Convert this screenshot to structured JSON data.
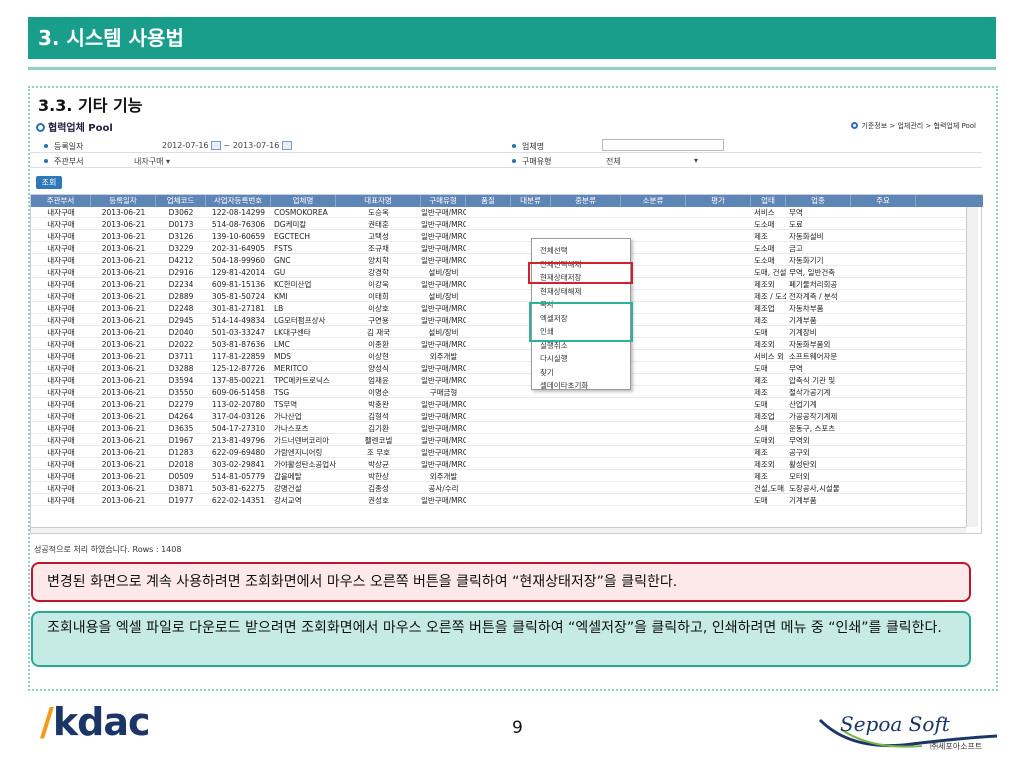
{
  "header": {
    "title": "3. 시스템 사용법"
  },
  "section": {
    "title": "3.3. 기타 기능"
  },
  "app": {
    "title": "협력업체 Pool",
    "breadcrumb": "기준정보 > 업체관리 > 협력업체 Pool",
    "form": {
      "reg_date_label": "등록일자",
      "date_from": "2012-07-16",
      "date_sep": "~",
      "date_to": "2013-07-16",
      "company_label": "업체명",
      "company_value": "",
      "dept_label": "주관부서",
      "dept_value": "내자구매",
      "purchase_type_label": "구매유형",
      "purchase_type_value": "전체"
    },
    "search_button": "조회",
    "columns": [
      "주관부서",
      "등록일자",
      "업체코드",
      "사업자등록번호",
      "업체명",
      "대표자명",
      "구매유형",
      "품질",
      "대분류",
      "중분류",
      "소분류",
      "평가",
      "업태",
      "업종",
      "주요"
    ],
    "rows": [
      [
        "내자구매",
        "2013-06-21",
        "D3062",
        "122-08-14299",
        "COSMOKOREA",
        "도승옥",
        "일반구매/MRO",
        "서비스",
        "무역"
      ],
      [
        "내자구매",
        "2013-06-21",
        "D0173",
        "514-08-76306",
        "DG케미칼",
        "권태훈",
        "일반구매/MRO",
        "도소매",
        "도료"
      ],
      [
        "내자구매",
        "2013-06-21",
        "D3126",
        "139-10-60659",
        "EGCTECH",
        "고택성",
        "일반구매/MRO",
        "제조",
        "자동화설비"
      ],
      [
        "내자구매",
        "2013-06-21",
        "D3229",
        "202-31-64905",
        "FSTS",
        "조규채",
        "일반구매/MRO",
        "도소매",
        "금고"
      ],
      [
        "내자구매",
        "2013-06-21",
        "D4212",
        "504-18-99960",
        "GNC",
        "양치학",
        "일반구매/MRO",
        "도소매",
        "자동화기기"
      ],
      [
        "내자구매",
        "2013-06-21",
        "D2916",
        "129-81-42014",
        "GU",
        "강경학",
        "설비/장비",
        "도매, 건설",
        "무역, 일반건축"
      ],
      [
        "내자구매",
        "2013-06-21",
        "D2234",
        "609-81-15136",
        "KC한미산업",
        "이강욱",
        "일반구매/MRO",
        "제조외",
        "폐기물처리회공"
      ],
      [
        "내자구매",
        "2013-06-21",
        "D2889",
        "305-81-50724",
        "KMI",
        "이태희",
        "설비/장비",
        "제조 / 도소매",
        "전자계측 / 분석"
      ],
      [
        "내자구매",
        "2013-06-21",
        "D2248",
        "301-81-27181",
        "LB",
        "이상호",
        "일반구매/MRO",
        "제조업",
        "자동차부품"
      ],
      [
        "내자구매",
        "2013-06-21",
        "D2945",
        "514-14-49834",
        "LG모터펌프상사",
        "구연용",
        "일반구매/MRO",
        "제조",
        "기계부품"
      ],
      [
        "내자구매",
        "2013-06-21",
        "D2040",
        "501-03-33247",
        "LK대구센타",
        "김 재국",
        "설비/장비",
        "도매",
        "기계장비"
      ],
      [
        "내자구매",
        "2013-06-21",
        "D2022",
        "503-81-87636",
        "LMC",
        "이종환",
        "일반구매/MRO",
        "제조외",
        "자동화부품외"
      ],
      [
        "내자구매",
        "2013-06-21",
        "D3711",
        "117-81-22859",
        "MDS",
        "이상현",
        "외주개발",
        "서비스 외",
        "소프트웨어자문"
      ],
      [
        "내자구매",
        "2013-06-21",
        "D3288",
        "125-12-87726",
        "MERITCO",
        "양성식",
        "일반구매/MRO",
        "도매",
        "무역"
      ],
      [
        "내자구매",
        "2013-06-21",
        "D3594",
        "137-85-00221",
        "TPC메카트로닉스",
        "엄재윤",
        "일반구매/MRO",
        "제조",
        "압축식 기관 및"
      ],
      [
        "내자구매",
        "2013-06-21",
        "D3550",
        "609-06-51458",
        "TSG",
        "이명순",
        "구매금형",
        "제조",
        "절삭가공기계"
      ],
      [
        "내자구매",
        "2013-06-21",
        "D2279",
        "113-02-20780",
        "TS무역",
        "박충완",
        "일반구매/MRO",
        "도매",
        "산업기계"
      ],
      [
        "내자구매",
        "2013-06-21",
        "D4264",
        "317-04-03126",
        "가나산업",
        "김형석",
        "일반구매/MRO",
        "제조업",
        "가공공작기계제"
      ],
      [
        "내자구매",
        "2013-06-21",
        "D3635",
        "504-17-27310",
        "가나스포츠",
        "김기환",
        "일반구매/MRO",
        "소매",
        "운동구, 스포츠"
      ],
      [
        "내자구매",
        "2013-06-21",
        "D1967",
        "213-81-49796",
        "가드너덴버코리아",
        "펠렌코넬",
        "일반구매/MRO",
        "도매외",
        "무역외"
      ],
      [
        "내자구매",
        "2013-06-21",
        "D1283",
        "622-09-69480",
        "가람엔지니어링",
        "조 무호",
        "일반구매/MRO",
        "제조",
        "공구외"
      ],
      [
        "내자구매",
        "2013-06-21",
        "D2018",
        "303-02-29841",
        "가야활성탄소공업사",
        "박상균",
        "일반구매/MRO",
        "제조외",
        "활성탄외"
      ],
      [
        "내자구매",
        "2013-06-21",
        "D0509",
        "514-81-05779",
        "갑을메탈",
        "박한상",
        "외주개발",
        "제조",
        "모터외"
      ],
      [
        "내자구매",
        "2013-06-21",
        "D3871",
        "503-81-62275",
        "강명건설",
        "김종성",
        "공사/수리",
        "건설,도매",
        "도장공사,시설물"
      ],
      [
        "내자구매",
        "2013-06-21",
        "D1977",
        "622-02-14351",
        "강서교역",
        "권성호",
        "일반구매/MRO",
        "도매",
        "기계부품"
      ]
    ],
    "status": "성공적으로 처리 하였습니다. Rows : 1408",
    "context_menu": [
      "전체선택",
      "전체선택해제",
      "현재상태저장",
      "현재상태해제",
      "복사",
      "엑셀저장",
      "인쇄",
      "실행취소",
      "다시실행",
      "찾기",
      "셀데이타초기화"
    ]
  },
  "notes": {
    "note1": "변경된 화면으로 계속 사용하려면 조회화면에서 마우스 오른쪽 버튼을 클릭하여 “현재상태저장”을 클릭한다.",
    "note2": "조회내용을 엑셀 파일로 다운로드 받으려면 조회화면에서 마우스 오른쪽 버튼을 클릭하여 “엑셀저장”을 클릭하고, 인쇄하려면 메뉴 중 “인쇄”를 클릭한다."
  },
  "footer": {
    "logo_left": "kdac",
    "page": "9",
    "logo_right": "Sepoa Soft",
    "logo_right_sub": "㈜세포아소프트"
  },
  "colors": {
    "header": "#1a9e8c",
    "grid_header": "#5d86b7",
    "highlight_red": "#d1202f",
    "highlight_green": "#2ab39a"
  }
}
